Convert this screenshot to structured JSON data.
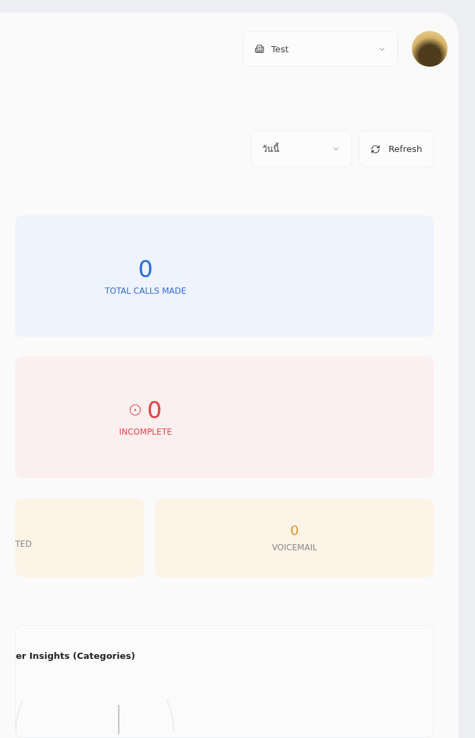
{
  "header": {
    "workspace": {
      "label": "Test"
    }
  },
  "filters": {
    "period": {
      "value": "วันนี้"
    },
    "refresh": {
      "label": "Refresh"
    }
  },
  "stats": [
    {
      "kind": "total",
      "value": "0",
      "label": "TOTAL CALLS MADE",
      "color": "#2f6fd6"
    },
    {
      "kind": "incomplete",
      "value": "0",
      "label": "INCOMPLETE",
      "color": "#e0464b"
    }
  ],
  "small_stats": [
    {
      "label": "TED"
    },
    {
      "value": "0",
      "label": "VOICEMAIL"
    }
  ],
  "insights": {
    "title": "er Insights (Categories)"
  }
}
